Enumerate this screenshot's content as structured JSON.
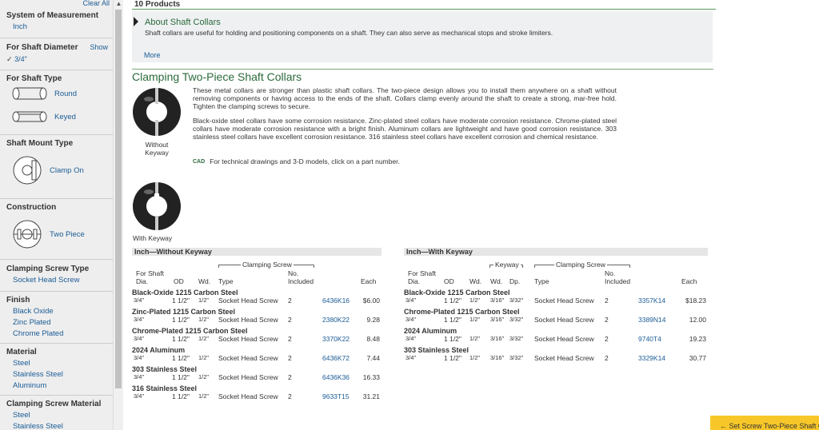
{
  "sidebar": {
    "clear_all": "Clear All",
    "measurement": {
      "title": "System of Measurement",
      "options": [
        "Inch"
      ]
    },
    "diameter": {
      "title": "For Shaft Diameter",
      "show": "Show",
      "check": "✓",
      "selected": "3/4\""
    },
    "type": {
      "title": "For Shaft Type",
      "options": [
        "Round",
        "Keyed"
      ]
    },
    "mount": {
      "title": "Shaft Mount Type",
      "options": [
        "Clamp On"
      ]
    },
    "construction": {
      "title": "Construction",
      "options": [
        "Two Piece"
      ]
    },
    "screw_type": {
      "title": "Clamping Screw Type",
      "options": [
        "Socket Head Screw"
      ]
    },
    "finish": {
      "title": "Finish",
      "options": [
        "Black Oxide",
        "Zinc Plated",
        "Chrome Plated"
      ]
    },
    "material": {
      "title": "Material",
      "options": [
        "Steel",
        "Stainless Steel",
        "Aluminum"
      ]
    },
    "screw_material": {
      "title": "Clamping Screw Material",
      "options": [
        "Steel",
        "Stainless Steel"
      ]
    }
  },
  "main": {
    "count": "10 Products",
    "about": {
      "title": "About Shaft Collars",
      "text": "Shaft collars are useful for holding and positioning components on a shaft. They can also serve as mechanical stops and stroke limiters.",
      "more": "More"
    },
    "heading": "Clamping Two-Piece Shaft Collars",
    "desc1": "These metal collars are stronger than plastic shaft collars. The two-piece design allows you to install them anywhere on a shaft without removing components or having access to the ends of the shaft. Collars clamp evenly around the shaft to create a strong, mar-free hold. Tighten the clamping screws to secure.",
    "desc2": "Black-oxide steel collars have some corrosion resistance. Zinc-plated steel collars have moderate corrosion resistance. Chrome-plated steel collars have moderate corrosion resistance with a bright finish. Aluminum collars are lightweight and have good corrosion resistance. 303 stainless steel collars have excellent corrosion resistance. 316 stainless steel collars have excellent corrosion and chemical resistance.",
    "cad_icon": "CAD",
    "cad_text": "For technical drawings and 3-D models, click on a part number.",
    "img1_caption": "Without Keyway",
    "img2_caption": "With Keyway",
    "set_screw_link": "← Set Screw Two-Piece Shaft Collars"
  },
  "table_a": {
    "title": "Inch—Without Keyway",
    "clamping_screw": "Clamping Screw",
    "headers": {
      "for_shaft": "For Shaft",
      "dia": "Dia.",
      "od": "OD",
      "wd": "Wd.",
      "type": "Type",
      "no": "No.",
      "included": "Included",
      "each": "Each"
    },
    "groups": [
      {
        "name": "Black-Oxide 1215 Carbon Steel",
        "dia": "3/4\"",
        "od": "1 1/2\"",
        "wd": "1/2\"",
        "type": "Socket Head Screw",
        "no": "2",
        "part": "6436K16",
        "price": "$6.00"
      },
      {
        "name": "Zinc-Plated 1215 Carbon Steel",
        "dia": "3/4\"",
        "od": "1 1/2\"",
        "wd": "1/2\"",
        "type": "Socket Head Screw",
        "no": "2",
        "part": "2380K22",
        "price": "9.28"
      },
      {
        "name": "Chrome-Plated 1215 Carbon Steel",
        "dia": "3/4\"",
        "od": "1 1/2\"",
        "wd": "1/2\"",
        "type": "Socket Head Screw",
        "no": "2",
        "part": "3370K22",
        "price": "8.48"
      },
      {
        "name": "2024 Aluminum",
        "dia": "3/4\"",
        "od": "1 1/2\"",
        "wd": "1/2\"",
        "type": "Socket Head Screw",
        "no": "2",
        "part": "6436K72",
        "price": "7.44"
      },
      {
        "name": "303 Stainless Steel",
        "dia": "3/4\"",
        "od": "1 1/2\"",
        "wd": "1/2\"",
        "type": "Socket Head Screw",
        "no": "2",
        "part": "6436K36",
        "price": "16.33"
      },
      {
        "name": "316 Stainless Steel",
        "dia": "3/4\"",
        "od": "1 1/2\"",
        "wd": "1/2\"",
        "type": "Socket Head Screw",
        "no": "2",
        "part": "9633T15",
        "price": "31.21"
      }
    ]
  },
  "table_b": {
    "title": "Inch—With Keyway",
    "keyway": "Keyway",
    "clamping_screw": "Clamping Screw",
    "headers": {
      "for_shaft": "For Shaft",
      "dia": "Dia.",
      "od": "OD",
      "wd": "Wd.",
      "kwd": "Wd.",
      "dp": "Dp.",
      "type": "Type",
      "no": "No.",
      "included": "Included",
      "each": "Each"
    },
    "groups": [
      {
        "name": "Black-Oxide 1215 Carbon Steel",
        "dia": "3/4\"",
        "od": "1 1/2\"",
        "wd": "1/2\"",
        "kwd": "3/16\"",
        "dp": "3/32\"",
        "type": "Socket Head Screw",
        "no": "2",
        "part": "3357K14",
        "price": "$18.23"
      },
      {
        "name": "Chrome-Plated 1215 Carbon Steel",
        "dia": "3/4\"",
        "od": "1 1/2\"",
        "wd": "1/2\"",
        "kwd": "3/16\"",
        "dp": "3/32\"",
        "type": "Socket Head Screw",
        "no": "2",
        "part": "3389N14",
        "price": "12.00"
      },
      {
        "name": "2024 Aluminum",
        "dia": "3/4\"",
        "od": "1 1/2\"",
        "wd": "1/2\"",
        "kwd": "3/16\"",
        "dp": "3/32\"",
        "type": "Socket Head Screw",
        "no": "2",
        "part": "9740T4",
        "price": "19.23"
      },
      {
        "name": "303 Stainless Steel",
        "dia": "3/4\"",
        "od": "1 1/2\"",
        "wd": "1/2\"",
        "kwd": "3/16\"",
        "dp": "3/32\"",
        "type": "Socket Head Screw",
        "no": "2",
        "part": "3329K14",
        "price": "30.77"
      }
    ]
  }
}
